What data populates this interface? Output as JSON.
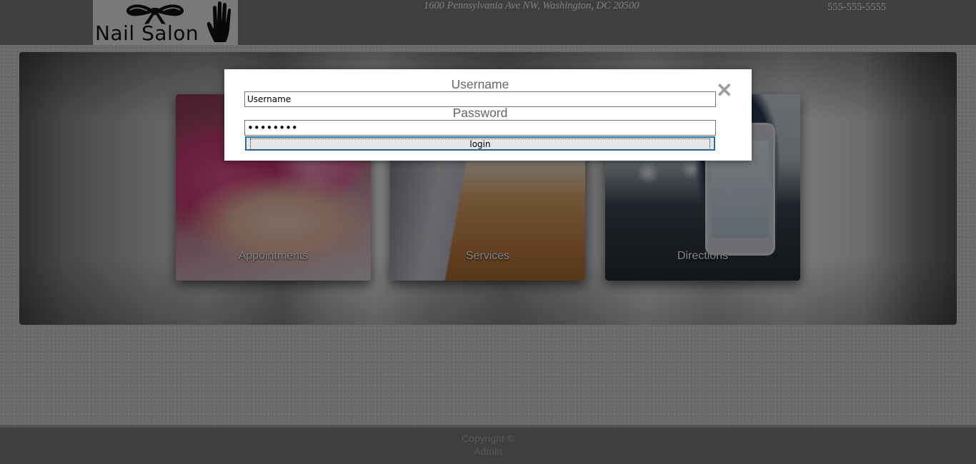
{
  "header": {
    "logo_text": "Nail Salon",
    "address": "1600 Pennsylvania Ave NW, Washington, DC 20500",
    "phone": "555-555-5555"
  },
  "cards": [
    {
      "label": "Appointments"
    },
    {
      "label": "Services"
    },
    {
      "label": "Directions"
    }
  ],
  "footer": {
    "line1": "Copyright ©",
    "line2": "Admin"
  },
  "login_modal": {
    "username_label": "Username",
    "username_value": "Username",
    "password_label": "Password",
    "password_value": "password",
    "login_button": "login",
    "close_icon": "close-icon"
  }
}
